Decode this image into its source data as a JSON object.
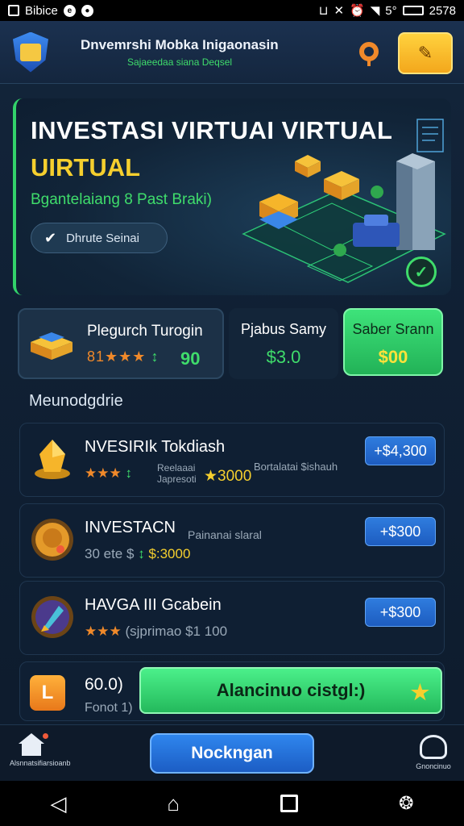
{
  "status_bar": {
    "left_text": "Bibice",
    "right_text": "5°",
    "time": "2578"
  },
  "header": {
    "title": "Dnvemrshi Mobka Inigaonasin",
    "subtitle": "Sajaeedaa siana Deqsel"
  },
  "hero": {
    "title_line1": "INVESTASI VIRTUAI VIRTUAL",
    "title_line2": "UIRTUAL",
    "subtitle": "Bgantelaiang 8 Past Braki)",
    "button_label": "Dhrute Seinai"
  },
  "stats": [
    {
      "label": "Plegurch Turogin",
      "rating_text": "81★★★",
      "rating_extra": "↕",
      "value": "90"
    },
    {
      "label": "Pjabus Samy",
      "value": "$3.0"
    },
    {
      "label": "Saber Srann",
      "value": "$00"
    }
  ],
  "section_label": "Meunodgdrie",
  "list": [
    {
      "title": "NVESIRIk Tokdiash",
      "stars": "★★★",
      "sub_extra": "↕",
      "sub_note": "Reelaaai\nJapresoti",
      "sub_value": "★3000",
      "right_note": "Bortalatai $ishauh",
      "price": "+$4,300"
    },
    {
      "title": "INVESTACN",
      "sub_prefix": "30 ete $",
      "sub_extra": "↕",
      "sub_value": "$:3000",
      "right_note": "Painanai slaral",
      "price": "+$300"
    },
    {
      "title": "HAVGA III Gcabein",
      "stars": "★★★",
      "sub_note": "(sjprimao $1 100",
      "price": "+$300"
    }
  ],
  "banner": {
    "badge": "L",
    "value": "60.0)",
    "sub": "Fonot 1)",
    "cta_label": "Alancinuo cistgl:)"
  },
  "bottom_nav": {
    "home_label": "Alsnnatsifiarsioanb",
    "main_label": "Nockngan",
    "right_label": "Gnoncinuo"
  },
  "colors": {
    "accent_green": "#3fdc6b",
    "accent_gold": "#f5cf2e",
    "accent_orange": "#f0892a",
    "accent_blue": "#2f7cde"
  }
}
